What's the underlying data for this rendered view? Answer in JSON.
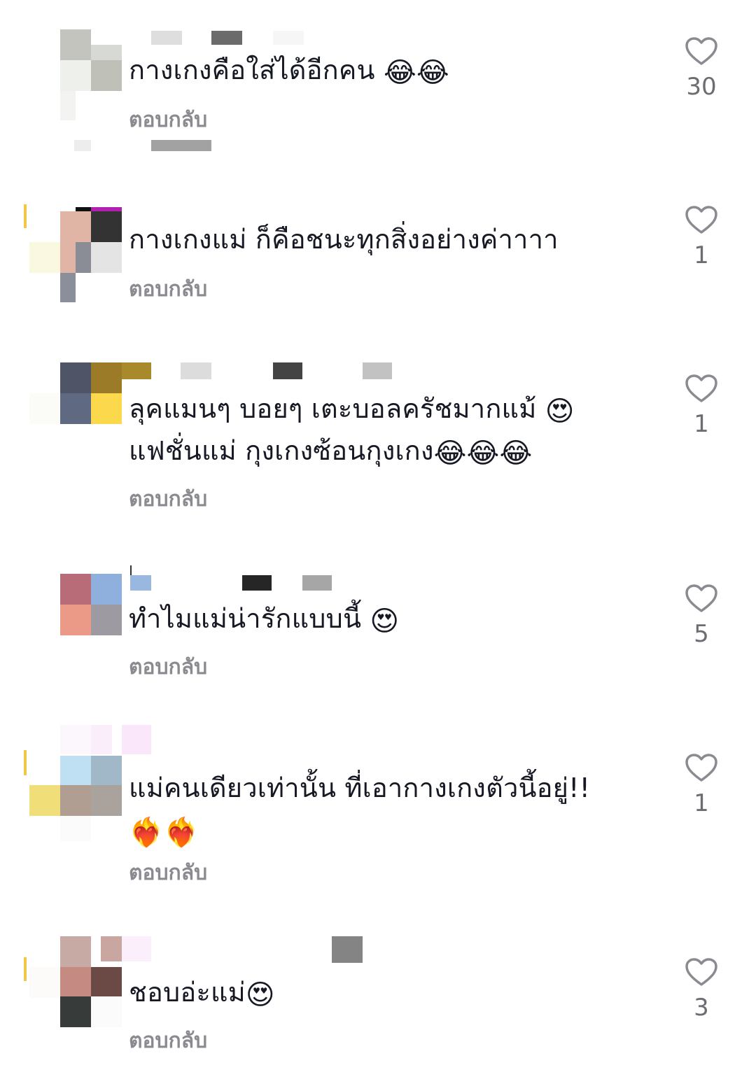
{
  "comments": [
    {
      "text": "กางเกงคือใส่ได้อีกคน",
      "emojis": "😂😂",
      "text2": "",
      "emojis2": "",
      "reply_label": "ตอบกลับ",
      "likes": "30"
    },
    {
      "text": "กางเกงแม่ ก็คือชนะทุกสิ่งอย่างค่าาาา",
      "emojis": "",
      "text2": "",
      "emojis2": "",
      "reply_label": "ตอบกลับ",
      "likes": "1"
    },
    {
      "text": "ลุคแมนๆ บอยๆ เตะบอลครัชมากแม้",
      "emojis": "😍",
      "text2": "แฟชั่นแม่ กุงเกงซ้อนกุงเกง",
      "emojis2": "😂😂😂",
      "reply_label": "ตอบกลับ",
      "likes": "1"
    },
    {
      "text": "ทำไมแม่น่ารักแบบนี้",
      "emojis": "😍",
      "text2": "",
      "emojis2": "",
      "reply_label": "ตอบกลับ",
      "likes": "5"
    },
    {
      "text": "แม่คนเดียวเท่านั้น ที่เอากางเกงตัวนี้อยู่!!",
      "emojis": "",
      "text2": "",
      "emojis2": "❤️‍🔥❤️‍🔥",
      "reply_label": "ตอบกลับ",
      "likes": "1"
    },
    {
      "text": "ชอบอ่ะแม่",
      "emojis": "😍",
      "text2": "",
      "emojis2": "",
      "reply_label": "ตอบกลับ",
      "likes": "3"
    }
  ],
  "icons": {
    "like": "heart-outline-icon"
  },
  "colors": {
    "text": "#161823",
    "reply": "#8a8b91",
    "like_count": "#6c6d72",
    "heart_stroke": "#8a8b91"
  }
}
